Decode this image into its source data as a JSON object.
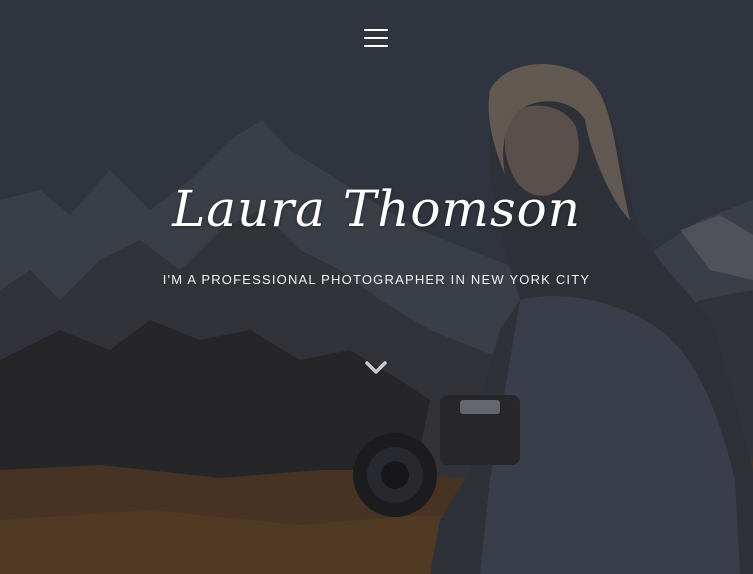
{
  "hero": {
    "name": "Laura Thomson",
    "tagline": "I'M A PROFESSIONAL PHOTOGRAPHER IN NEW YORK CITY"
  },
  "icons": {
    "menu": "hamburger-menu-icon",
    "scroll": "chevron-down-icon"
  },
  "colors": {
    "text": "#ffffff",
    "overlay": "#282c34"
  }
}
